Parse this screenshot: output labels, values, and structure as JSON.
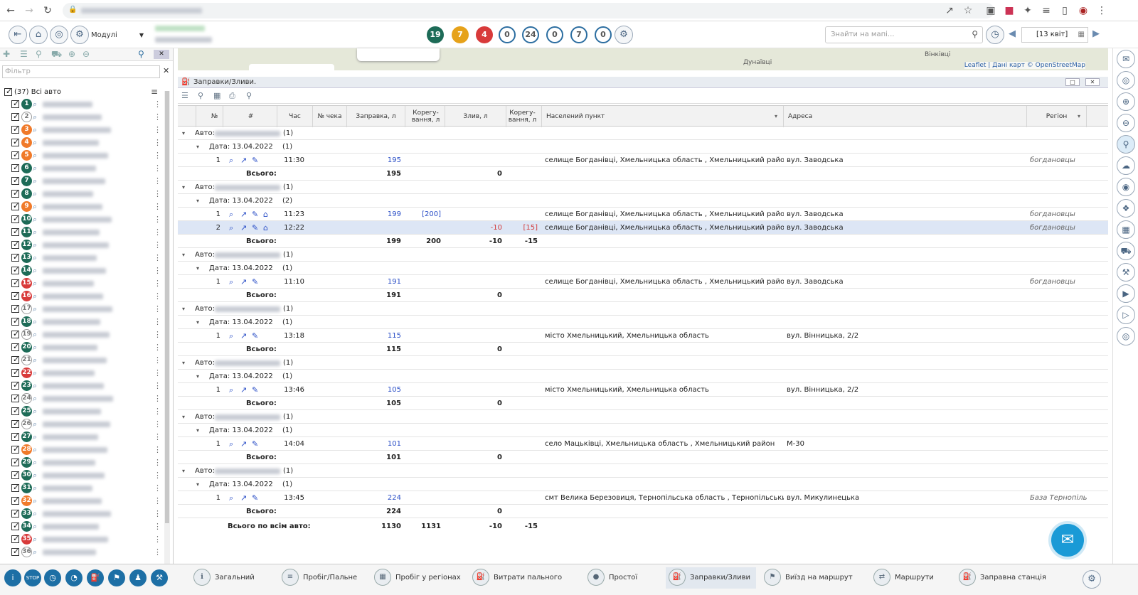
{
  "browser": {
    "url_blur": "dbc.com/app/index.html"
  },
  "toolbar": {
    "modules_label": "Модулі",
    "search_placeholder": "Знайти на мапі...",
    "date_value": "[13 квіт]",
    "counters": [
      {
        "v": "19",
        "c": "#1d6b57"
      },
      {
        "v": "7",
        "c": "#e6a21a"
      },
      {
        "v": "4",
        "c": "#d83a3a"
      },
      {
        "v": "0",
        "c": "o"
      },
      {
        "v": "24",
        "c": "o"
      },
      {
        "v": "0",
        "c": "o"
      },
      {
        "v": "7",
        "c": "o"
      },
      {
        "v": "0",
        "c": "o"
      }
    ]
  },
  "sidebar": {
    "filter_placeholder": "Фільтр",
    "all_label": "(37) Всі авто",
    "vehicles": [
      {
        "n": "1",
        "c": "g"
      },
      {
        "n": "2",
        "c": "w"
      },
      {
        "n": "3",
        "c": "o"
      },
      {
        "n": "4",
        "c": "o"
      },
      {
        "n": "5",
        "c": "o"
      },
      {
        "n": "6",
        "c": "g"
      },
      {
        "n": "7",
        "c": "g"
      },
      {
        "n": "8",
        "c": "g"
      },
      {
        "n": "9",
        "c": "o"
      },
      {
        "n": "10",
        "c": "g"
      },
      {
        "n": "11",
        "c": "g"
      },
      {
        "n": "12",
        "c": "g"
      },
      {
        "n": "13",
        "c": "g"
      },
      {
        "n": "14",
        "c": "g"
      },
      {
        "n": "15",
        "c": "r"
      },
      {
        "n": "16",
        "c": "r"
      },
      {
        "n": "17",
        "c": "w"
      },
      {
        "n": "18",
        "c": "g"
      },
      {
        "n": "19",
        "c": "w"
      },
      {
        "n": "20",
        "c": "g"
      },
      {
        "n": "21",
        "c": "w"
      },
      {
        "n": "22",
        "c": "r"
      },
      {
        "n": "23",
        "c": "g"
      },
      {
        "n": "24",
        "c": "w"
      },
      {
        "n": "25",
        "c": "g"
      },
      {
        "n": "26",
        "c": "w"
      },
      {
        "n": "27",
        "c": "g"
      },
      {
        "n": "28",
        "c": "o"
      },
      {
        "n": "29",
        "c": "g"
      },
      {
        "n": "30",
        "c": "g"
      },
      {
        "n": "31",
        "c": "g"
      },
      {
        "n": "32",
        "c": "o"
      },
      {
        "n": "33",
        "c": "g"
      },
      {
        "n": "34",
        "c": "g"
      },
      {
        "n": "35",
        "c": "r"
      },
      {
        "n": "36",
        "c": "w"
      }
    ]
  },
  "map": {
    "label": "Дунаївці",
    "label2": "Вінківці",
    "attribution": "Leaflet | Дані карт © OpenStreetMap"
  },
  "panel": {
    "title": "Заправки/Зливи.",
    "headers": [
      "№",
      "#",
      "Час",
      "№ чека",
      "Заправка, л",
      "Корегу-вання, л",
      "Злив, л",
      "Корегу-вання, л",
      "Населений пункт",
      "Адреса",
      "Регіон"
    ],
    "auto_label": "Авто:",
    "date_label": "Дата: 13.04.2022",
    "total_label": "Всього:",
    "grand_label": "Всього по всім авто:",
    "groups": [
      {
        "count": "(1)",
        "dcount": "(1)",
        "rows": [
          {
            "n": "1",
            "t": "11:30",
            "fill": "195",
            "fc": "",
            "drain": "",
            "dc": "",
            "place": "селище Богданівці, Хмельницька область , Хмельницький район",
            "addr": "вул. Заводська",
            "region": "богдановцы"
          }
        ],
        "tot": [
          "195",
          "",
          "0",
          ""
        ]
      },
      {
        "count": "(1)",
        "dcount": "(2)",
        "rows": [
          {
            "n": "1",
            "t": "11:23",
            "fill": "199",
            "fc": "[200]",
            "drain": "",
            "dc": "",
            "place": "селище Богданівці, Хмельницька область , Хмельницький район",
            "addr": "вул. Заводська",
            "region": "богдановцы"
          },
          {
            "n": "2",
            "t": "12:22",
            "fill": "",
            "fc": "",
            "drain": "-10",
            "dc": "[15]",
            "place": "селище Богданівці, Хмельницька область , Хмельницький район",
            "addr": "вул. Заводська",
            "region": "богдановцы",
            "sel": true
          }
        ],
        "tot": [
          "199",
          "200",
          "-10",
          "-15"
        ]
      },
      {
        "count": "(1)",
        "dcount": "(1)",
        "rows": [
          {
            "n": "1",
            "t": "11:10",
            "fill": "191",
            "fc": "",
            "drain": "",
            "dc": "",
            "place": "селище Богданівці, Хмельницька область , Хмельницький район",
            "addr": "вул. Заводська",
            "region": "богдановцы"
          }
        ],
        "tot": [
          "191",
          "",
          "0",
          ""
        ]
      },
      {
        "count": "(1)",
        "dcount": "(1)",
        "rows": [
          {
            "n": "1",
            "t": "13:18",
            "fill": "115",
            "fc": "",
            "drain": "",
            "dc": "",
            "place": "місто Хмельницький, Хмельницька область",
            "addr": "вул. Вінницька, 2/2",
            "region": ""
          }
        ],
        "tot": [
          "115",
          "",
          "0",
          ""
        ]
      },
      {
        "count": "(1)",
        "dcount": "(1)",
        "rows": [
          {
            "n": "1",
            "t": "13:46",
            "fill": "105",
            "fc": "",
            "drain": "",
            "dc": "",
            "place": "місто Хмельницький, Хмельницька область",
            "addr": "вул. Вінницька, 2/2",
            "region": ""
          }
        ],
        "tot": [
          "105",
          "",
          "0",
          ""
        ]
      },
      {
        "count": "(1)",
        "dcount": "(1)",
        "rows": [
          {
            "n": "1",
            "t": "14:04",
            "fill": "101",
            "fc": "",
            "drain": "",
            "dc": "",
            "place": "село Мацьківці, Хмельницька область , Хмельницький район",
            "addr": "М-30",
            "region": ""
          }
        ],
        "tot": [
          "101",
          "",
          "0",
          ""
        ]
      },
      {
        "count": "(1)",
        "dcount": "(1)",
        "rows": [
          {
            "n": "1",
            "t": "13:45",
            "fill": "224",
            "fc": "",
            "drain": "",
            "dc": "",
            "place": "смт Велика Березовиця, Тернопільська область , Тернопільський ра...",
            "addr": "вул. Микулинецька",
            "region": "База Тернопіль"
          }
        ],
        "tot": [
          "224",
          "",
          "0",
          ""
        ]
      }
    ],
    "grand": [
      "1130",
      "1131",
      "-10",
      "-15"
    ]
  },
  "bottom": {
    "tabs": [
      "Загальний",
      "Пробіг/Пальне",
      "Пробіг у регіонах",
      "Витрати пального",
      "Простої",
      "Заправки/Зливи",
      "Виїзд на маршрут",
      "Маршрути",
      "Заправна станція"
    ],
    "stop_label": "STOP"
  }
}
